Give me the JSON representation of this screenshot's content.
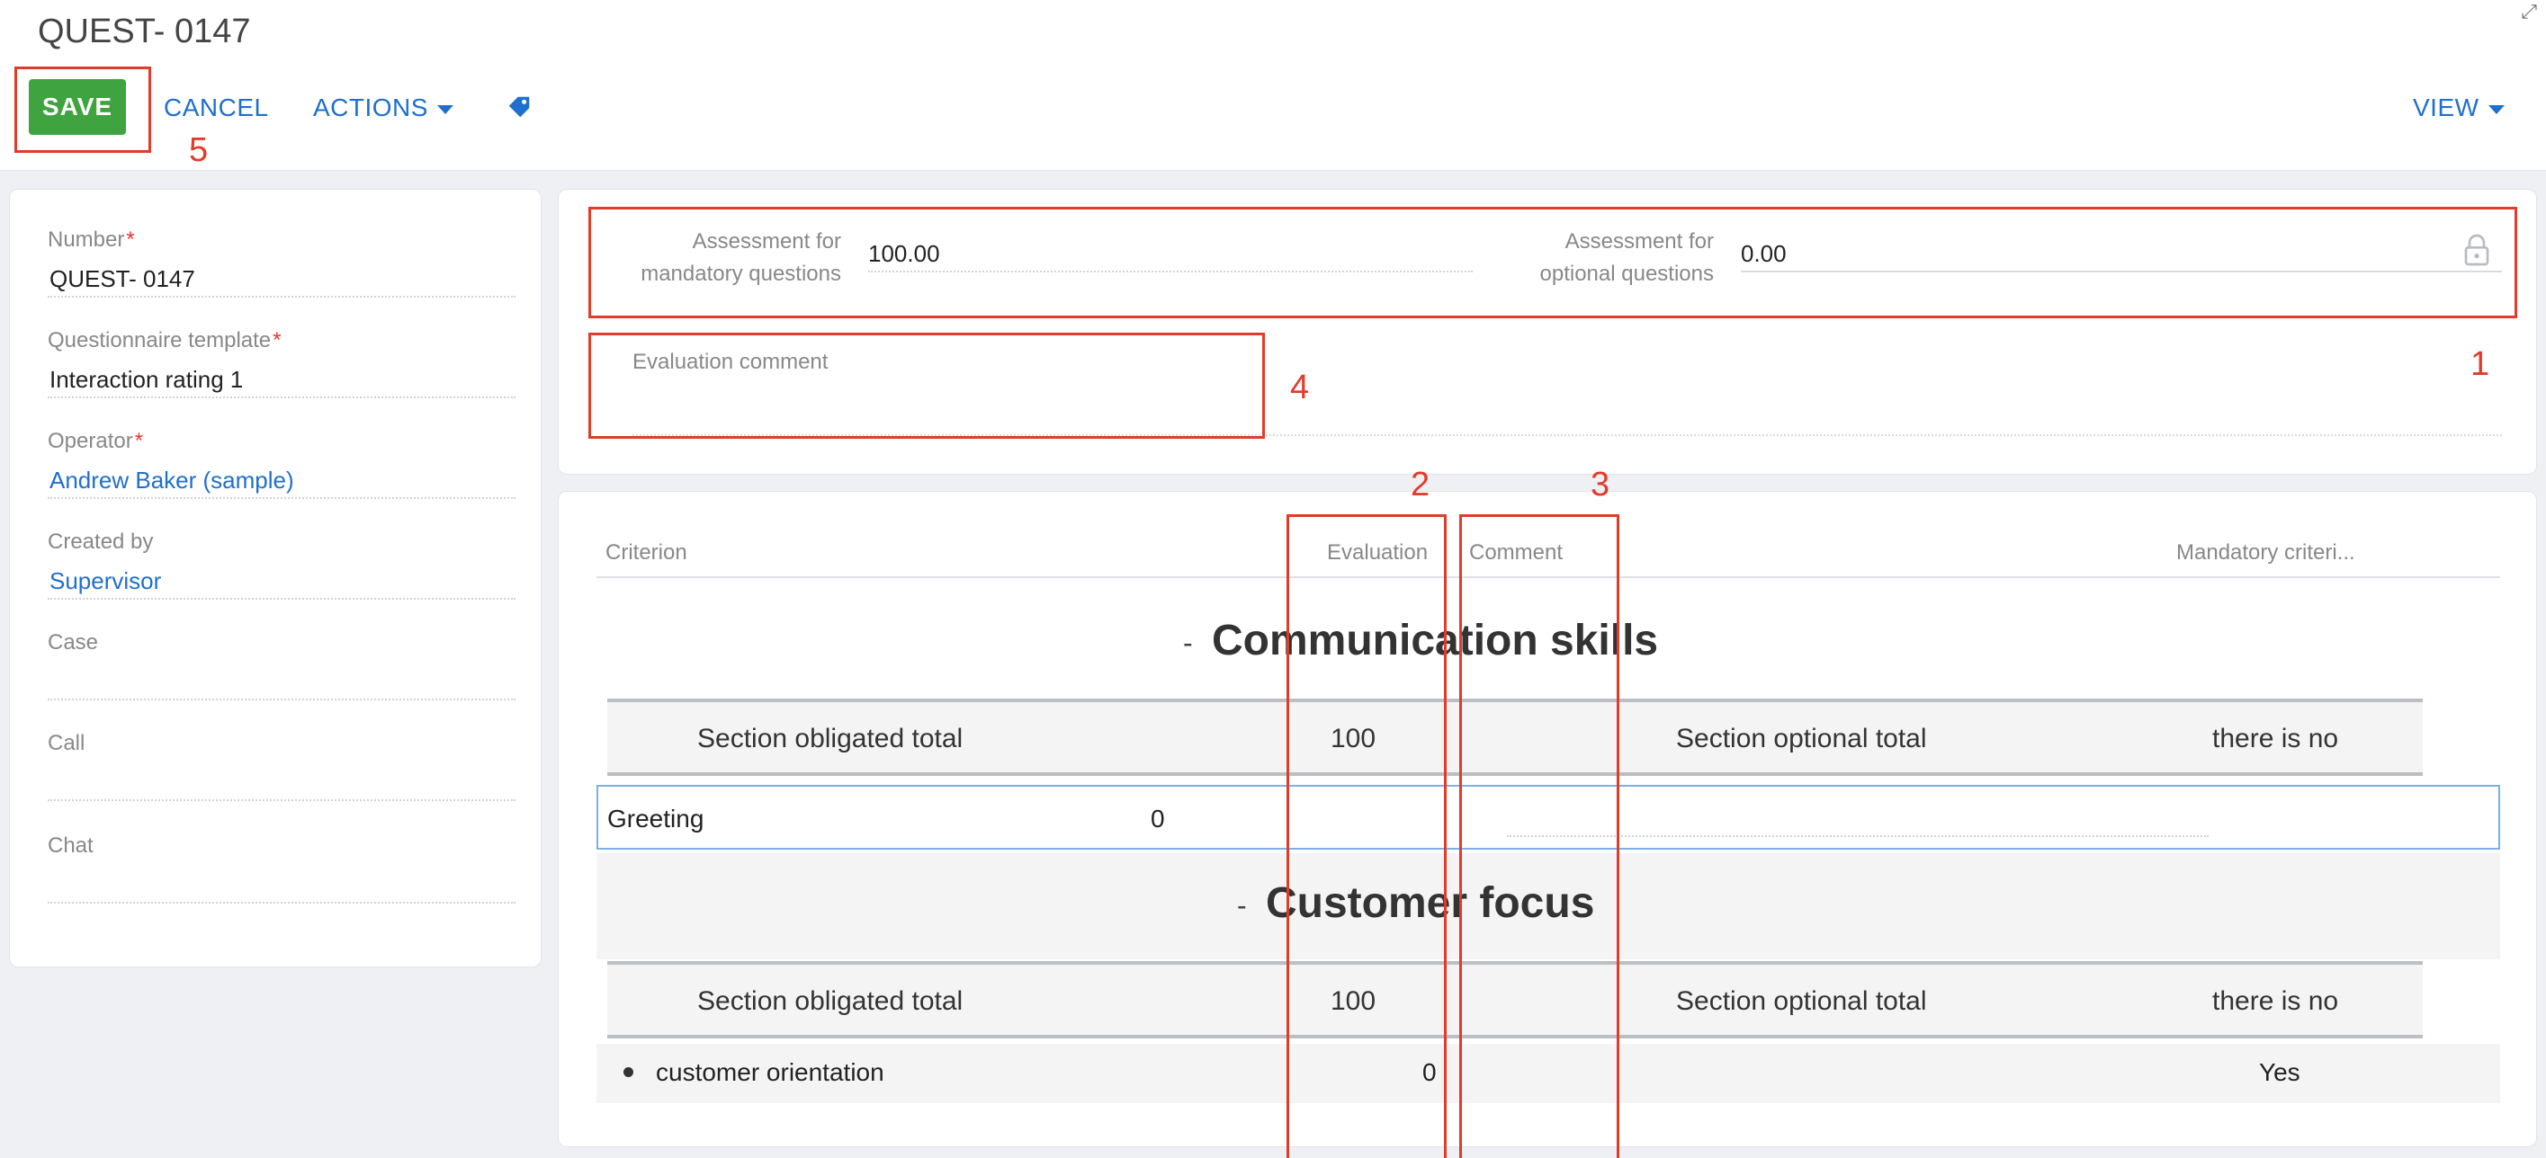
{
  "header": {
    "title": "QUEST- 0147",
    "save_label": "SAVE",
    "cancel_label": "CANCEL",
    "actions_label": "ACTIONS",
    "view_label": "VIEW"
  },
  "sidebar": {
    "fields": [
      {
        "label": "Number",
        "value": "QUEST- 0147",
        "required": true
      },
      {
        "label": "Questionnaire template",
        "value": "Interaction rating 1",
        "required": true
      },
      {
        "label": "Operator",
        "value": "Andrew Baker (sample)",
        "required": true
      },
      {
        "label": "Created by",
        "value": "Supervisor"
      },
      {
        "label": "Case",
        "value": ""
      },
      {
        "label": "Call",
        "value": ""
      },
      {
        "label": "Chat",
        "value": ""
      }
    ]
  },
  "assessment": {
    "mandatory_label_1": "Assessment for",
    "mandatory_label_2": "mandatory questions",
    "mandatory_value": "100.00",
    "optional_label_1": "Assessment for",
    "optional_label_2": "optional questions",
    "optional_value": "0.00",
    "evaluation_comment_label": "Evaluation comment"
  },
  "criteria_table": {
    "columns": [
      "Criterion",
      "Evaluation",
      "Comment",
      "Mandatory criteri..."
    ],
    "sections": [
      {
        "title": "Communication skills",
        "obligated_label": "Section obligated total",
        "obligated_value": "100",
        "optional_label": "Section optional total",
        "optional_value": "there is no",
        "rows": [
          {
            "criterion": "Greeting",
            "evaluation": "0"
          }
        ]
      },
      {
        "title": "Customer focus",
        "obligated_label": "Section obligated total",
        "obligated_value": "100",
        "optional_label": "Section optional total",
        "optional_value": "there is no",
        "rows": [
          {
            "criterion": "customer orientation",
            "evaluation": "0",
            "mandatory": "Yes"
          }
        ]
      }
    ],
    "collapse_symbol": "-"
  },
  "annotations": {
    "labels": [
      "1",
      "2",
      "3",
      "4",
      "5"
    ],
    "color": "#e23b2a"
  },
  "colors": {
    "save_button": "#3fa33f",
    "link": "#1f6fce",
    "required_mark": "#e8352a"
  }
}
